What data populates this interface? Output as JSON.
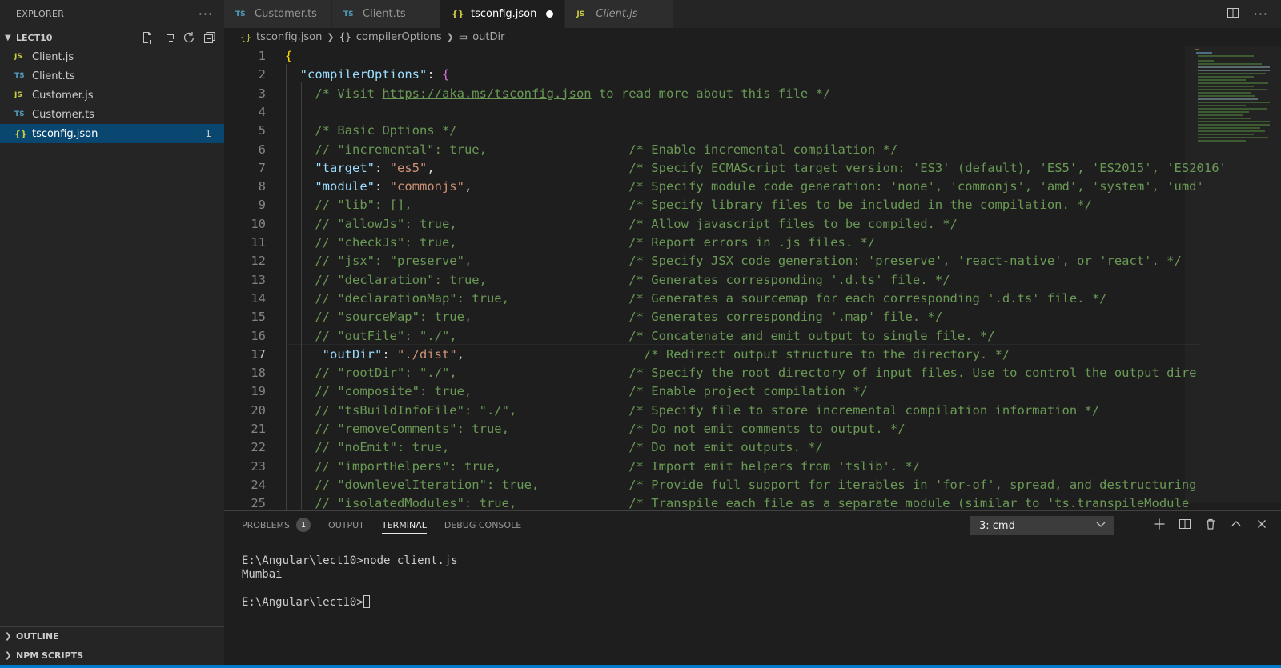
{
  "explorer": {
    "title": "EXPLORER",
    "more": "···",
    "folder": "LECT10",
    "files": [
      {
        "name": "Client.js",
        "type": "JS"
      },
      {
        "name": "Client.ts",
        "type": "TS"
      },
      {
        "name": "Customer.js",
        "type": "JS"
      },
      {
        "name": "Customer.ts",
        "type": "TS"
      },
      {
        "name": "tsconfig.json",
        "type": "{}",
        "badge": "1"
      }
    ],
    "outline": "OUTLINE",
    "npm_scripts": "NPM SCRIPTS"
  },
  "tabs": [
    {
      "label": "Customer.ts",
      "icon": "TS"
    },
    {
      "label": "Client.ts",
      "icon": "TS"
    },
    {
      "label": "tsconfig.json",
      "icon": "{}"
    },
    {
      "label": "Client.js",
      "icon": "JS"
    }
  ],
  "breadcrumb": {
    "file": "tsconfig.json",
    "icon_obj": "{}",
    "section": "compilerOptions",
    "icon_prop": "▭",
    "prop": "outDir"
  },
  "editor": {
    "line_numbers": [
      "1",
      "2",
      "3",
      "4",
      "5",
      "6",
      "7",
      "8",
      "9",
      "10",
      "11",
      "12",
      "13",
      "14",
      "15",
      "16",
      "17",
      "18",
      "19",
      "20",
      "21",
      "22",
      "23",
      "24",
      "25"
    ],
    "current_line": 17
  },
  "panel": {
    "tabs": [
      "PROBLEMS",
      "OUTPUT",
      "TERMINAL",
      "DEBUG CONSOLE"
    ],
    "problems_count": "1",
    "terminal_select": "3: cmd",
    "terminal_lines": [
      "E:\\Angular\\lect10>node client.js",
      "Mumbai",
      "",
      "E:\\Angular\\lect10>"
    ]
  },
  "colors": {
    "accent": "#007acc",
    "selection": "#094771",
    "key": "#9cdcfe",
    "string": "#ce9178",
    "comment": "#6a9955"
  }
}
